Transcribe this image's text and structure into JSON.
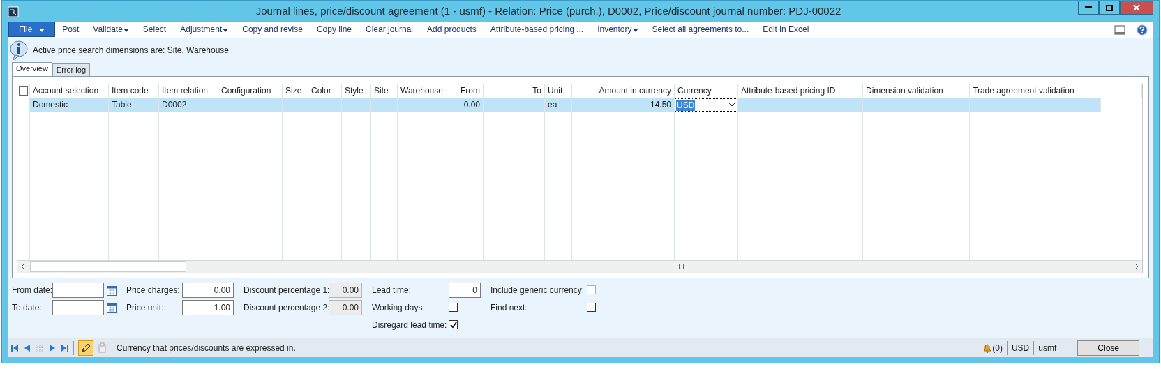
{
  "window": {
    "title": "Journal lines, price/discount agreement (1 - usmf) - Relation: Price (purch.), D0002, Price/discount journal number: PDJ-00022"
  },
  "menu": [
    {
      "label": "File",
      "kind": "file"
    },
    {
      "label": "Post",
      "kind": "plain"
    },
    {
      "label": "Validate",
      "kind": "dropdown"
    },
    {
      "label": "Select",
      "kind": "plain"
    },
    {
      "label": "Adjustment",
      "kind": "dropdown"
    },
    {
      "label": "Copy and revise",
      "kind": "plain"
    },
    {
      "label": "Copy line",
      "kind": "plain"
    },
    {
      "label": "Clear journal",
      "kind": "plain"
    },
    {
      "label": "Add products",
      "kind": "plain"
    },
    {
      "label": "Attribute-based pricing ...",
      "kind": "plain"
    },
    {
      "label": "Inventory",
      "kind": "dropdown"
    },
    {
      "label": "Select all agreements to...",
      "kind": "plain"
    },
    {
      "label": "Edit in Excel",
      "kind": "plain"
    }
  ],
  "info": "Active price search dimensions are: Site, Warehouse",
  "tabs": [
    {
      "label": "Overview",
      "selected": true
    },
    {
      "label": "Error log",
      "selected": false
    }
  ],
  "grid": {
    "select_all": {
      "checked": false
    },
    "columns": [
      {
        "label": "Account selection"
      },
      {
        "label": "Item code"
      },
      {
        "label": "Item relation"
      },
      {
        "label": "Configuration"
      },
      {
        "label": "Size"
      },
      {
        "label": "Color"
      },
      {
        "label": "Style"
      },
      {
        "label": "Site"
      },
      {
        "label": "Warehouse"
      },
      {
        "label": "From"
      },
      {
        "label": "To"
      },
      {
        "label": "Unit"
      },
      {
        "label": "Amount in currency"
      },
      {
        "label": "Currency"
      },
      {
        "label": "Attribute-based pricing ID"
      },
      {
        "label": "Dimension validation"
      },
      {
        "label": "Trade agreement validation"
      }
    ],
    "rows": [
      {
        "selected": true,
        "cells": [
          {
            "text": "Domestic"
          },
          {
            "text": "Table"
          },
          {
            "text": "D0002"
          },
          {},
          {},
          {},
          {},
          {},
          {},
          {
            "text": "0.00"
          },
          {},
          {
            "text": "ea"
          },
          {
            "text": "14.50"
          },
          {
            "text": "USD",
            "kind": "combo"
          },
          {},
          {},
          {}
        ]
      }
    ]
  },
  "fields": [
    [
      {
        "label": "From date:",
        "kind": "date"
      },
      {
        "label": "To date:",
        "kind": "date"
      }
    ],
    [
      {
        "label": "Price charges:",
        "kind": "number",
        "value": "0.00",
        "disabled": false
      },
      {
        "label": "Price unit:",
        "kind": "number",
        "value": "1.00",
        "disabled": false
      }
    ],
    [
      {
        "label": "Discount percentage 1:",
        "kind": "number",
        "value": "0.00",
        "disabled": true
      },
      {
        "label": "Discount percentage 2:",
        "kind": "number",
        "value": "0.00",
        "disabled": true
      }
    ],
    [
      {
        "label": "Lead time:",
        "kind": "number",
        "value": "0",
        "disabled": false
      },
      {
        "label": "Working days:",
        "kind": "check",
        "checked": false,
        "disabled": false
      },
      {
        "label": "Disregard lead time:",
        "kind": "check",
        "checked": true,
        "disabled": false
      }
    ],
    [
      {
        "label": "Include generic currency:",
        "kind": "check",
        "checked": false,
        "disabled": true
      },
      {
        "label": "Find next:",
        "kind": "check",
        "checked": false,
        "disabled": false
      }
    ]
  ],
  "status": {
    "help": "Currency that prices/discounts are expressed in.",
    "edit_mode": true,
    "alerts": "(0)",
    "currency": "USD",
    "company": "usmf",
    "close": "Close"
  }
}
